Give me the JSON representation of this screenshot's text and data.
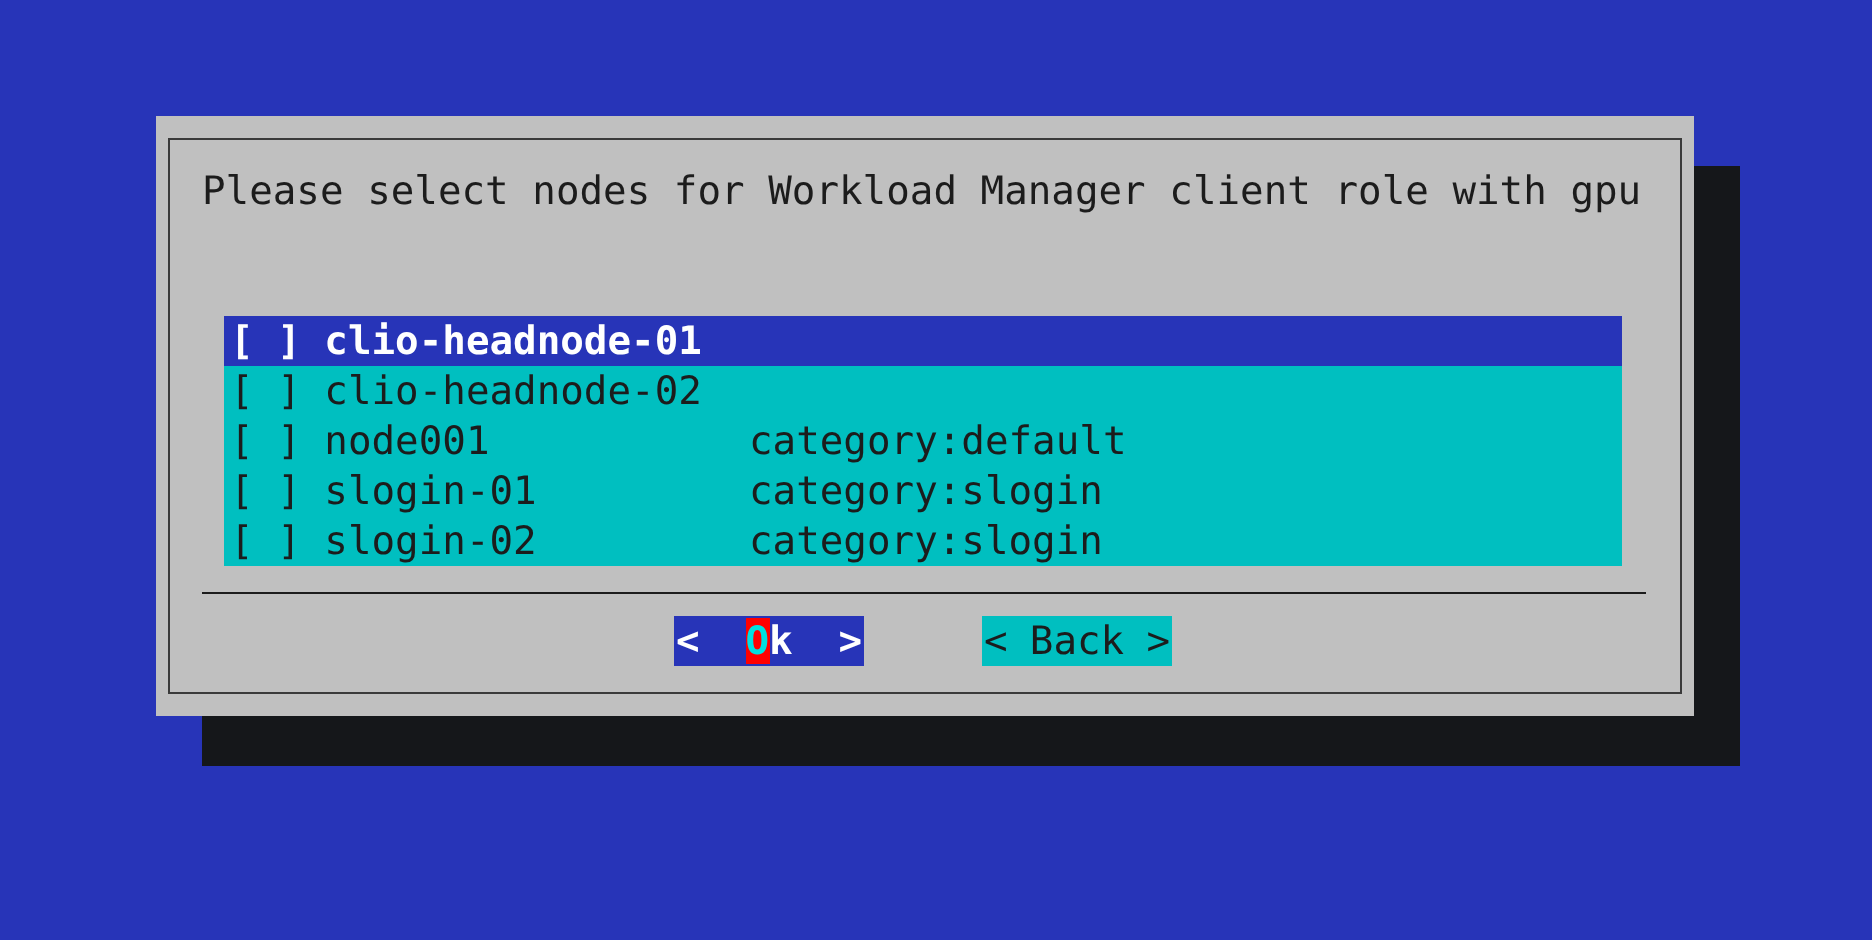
{
  "dialog": {
    "prompt": "Please select nodes for Workload Manager client role with gpu",
    "items": [
      {
        "checkbox": "[ ]",
        "name": "clio-headnode-01",
        "selected": true
      },
      {
        "checkbox": "[ ]",
        "name": "clio-headnode-02",
        "selected": false
      },
      {
        "checkbox": "[ ]",
        "name": "node001",
        "category": "category:default",
        "selected": false
      },
      {
        "checkbox": "[ ]",
        "name": "slogin-01",
        "category": "category:slogin",
        "selected": false
      },
      {
        "checkbox": "[ ]",
        "name": "slogin-02",
        "category": "category:slogin",
        "selected": false
      }
    ],
    "buttons": [
      {
        "left": "<",
        "hotkey": "O",
        "rest": "k",
        "right": ">",
        "selected": true
      },
      {
        "left": "<",
        "hotkey": "B",
        "rest": "ack",
        "right": ">",
        "selected": false
      }
    ]
  }
}
